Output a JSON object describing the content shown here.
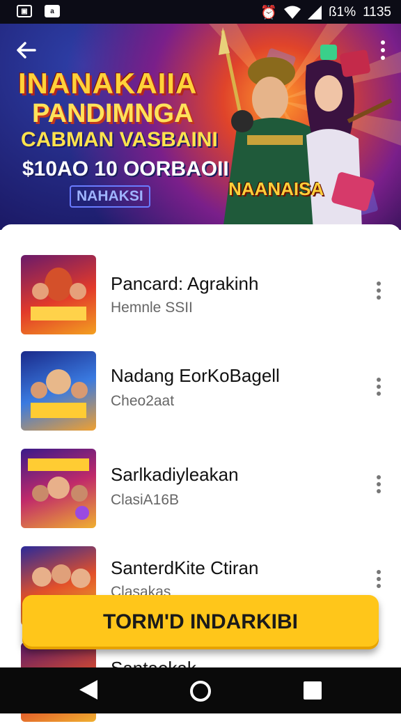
{
  "status_bar": {
    "battery": "ß1%",
    "time": "1135",
    "icons": [
      "image-notification-icon",
      "app-notification-icon",
      "alarm-icon",
      "wifi-icon",
      "signal-icon"
    ]
  },
  "hero": {
    "line1": "INANAKAIIA",
    "line2": "PANDIMNGA",
    "line3": "CABMAN VASBAINI",
    "line4": "$10AO 10 OORBAOII",
    "line5": "NAHAKSI",
    "logo": "NAANAISA"
  },
  "items": [
    {
      "title": "Pancard: Agrakinh",
      "subtitle": "Hemnle SSII",
      "thumb_text": "SANUKAILI"
    },
    {
      "title": "Nadang EorKoBagell",
      "subtitle": "Cheo2aat",
      "thumb_text": "SABNAIH"
    },
    {
      "title": "Sarlkadiyleakan",
      "subtitle": "ClasiA16B",
      "thumb_text": "NAHAOER"
    },
    {
      "title": "SanterdKite Ctiran",
      "subtitle": "Clasakas",
      "thumb_text": "CORLAIS"
    },
    {
      "title": "Santaekak",
      "subtitle": "",
      "thumb_text": "ZNAVAU"
    }
  ],
  "cta": {
    "label": "TORM'D INDARKIBI"
  },
  "colors": {
    "accent": "#ffc61a",
    "status_bar": "#0c0c16",
    "nav_bar": "#0a0a0a"
  }
}
